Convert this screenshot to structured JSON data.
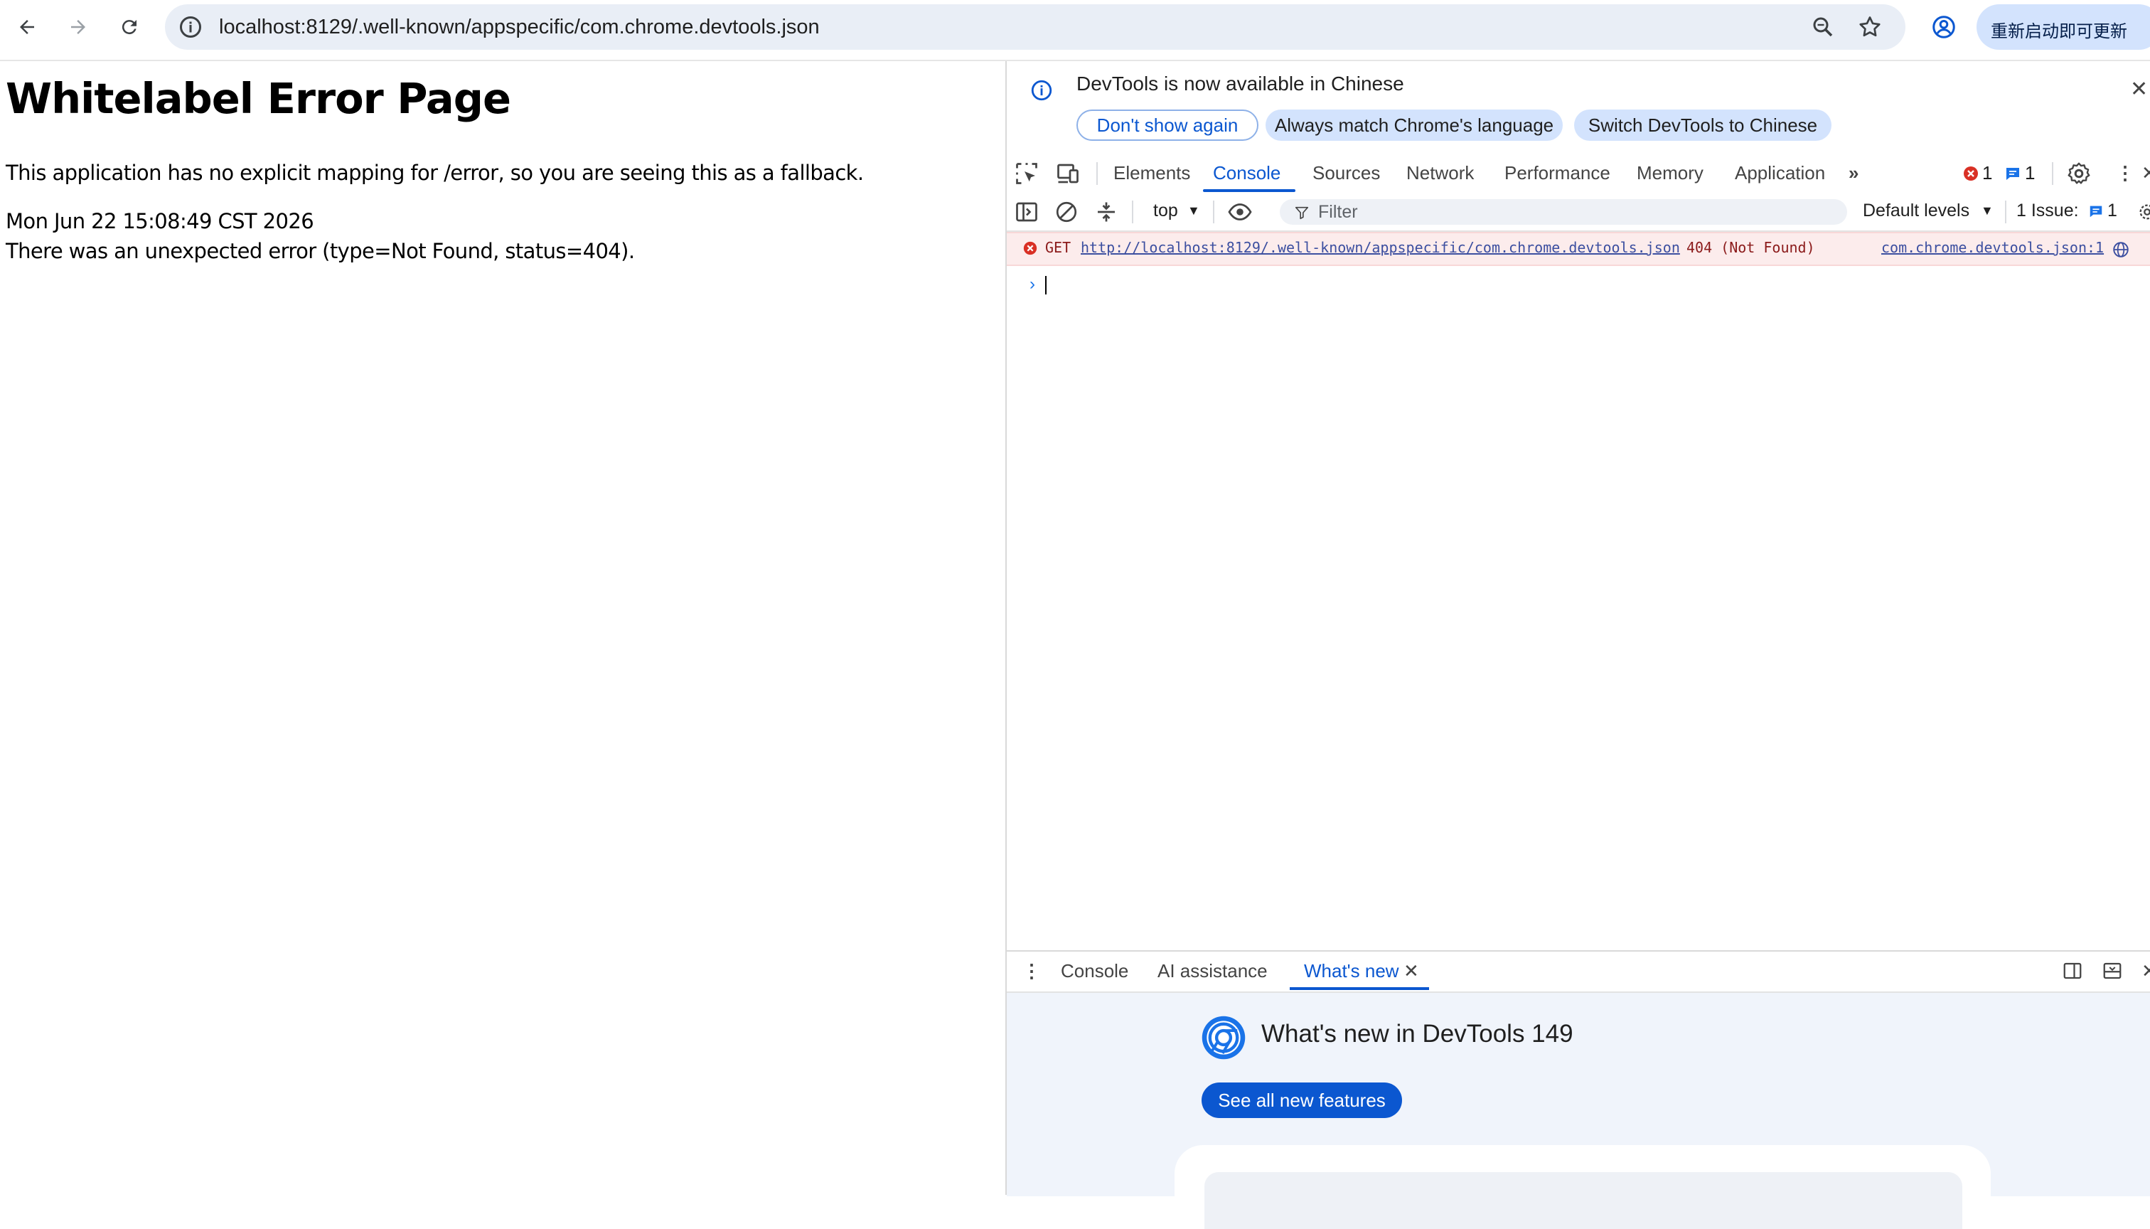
{
  "browser": {
    "url": "localhost:8129/.well-known/appspecific/com.chrome.devtools.json",
    "update_label": "重新启动即可更新"
  },
  "page": {
    "title": "Whitelabel Error Page",
    "line1": "This application has no explicit mapping for /error, so you are seeing this as a fallback.",
    "timestamp": "Mon Jun 22 15:08:49 CST 2026",
    "error_line": "There was an unexpected error (type=Not Found, status=404)."
  },
  "devtools": {
    "infobar": {
      "message": "DevTools is now available in Chinese",
      "dont_show": "Don't show again",
      "match_language": "Always match Chrome's language",
      "switch_chinese": "Switch DevTools to Chinese"
    },
    "tabs": [
      "Elements",
      "Console",
      "Sources",
      "Network",
      "Performance",
      "Memory",
      "Application"
    ],
    "active_tab": "Console",
    "error_count": "1",
    "message_count": "1",
    "console_toolbar": {
      "context": "top",
      "filter_placeholder": "Filter",
      "levels": "Default levels",
      "issues_label": "1 Issue:",
      "issues_count": "1"
    },
    "console_error": {
      "method": "GET",
      "url": "http://localhost:8129/.well-known/appspecific/com.chrome.devtools.json",
      "status": "404 (Not Found)",
      "source": "com.chrome.devtools.json:1"
    },
    "drawer": {
      "tabs": [
        "Console",
        "AI assistance",
        "What's new"
      ],
      "active_tab": "What's new",
      "whats_new_title": "What's new in DevTools 149",
      "see_all": "See all new features"
    }
  },
  "colors": {
    "accent": "#0b57d0",
    "error_bg": "#fcecec",
    "error_red": "#d93025",
    "omnibox_bg": "#e9eef6"
  }
}
